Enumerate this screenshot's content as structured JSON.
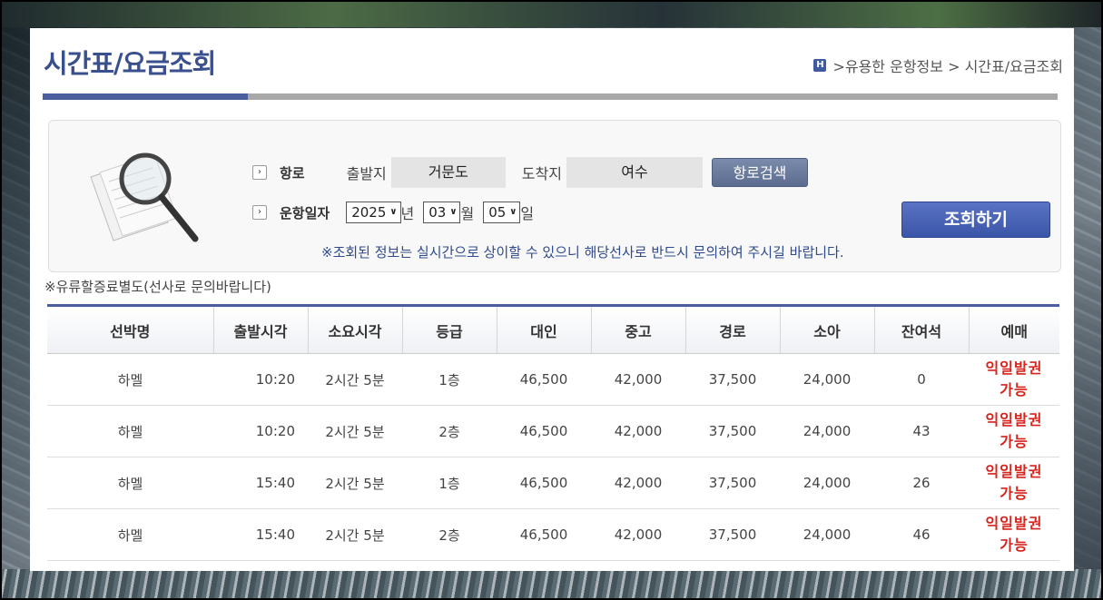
{
  "page": {
    "title": "시간표/요금조회",
    "breadcrumb": {
      "home_icon": "home-icon",
      "path": ">유용한 운항정보 > 시간표/요금조회"
    }
  },
  "search": {
    "route_label": "항로",
    "departure_label": "출발지",
    "departure_value": "거문도",
    "arrival_label": "도착지",
    "arrival_value": "여수",
    "route_button": "항로검색",
    "date_label": "운항일자",
    "year": "2025",
    "year_unit": "년",
    "month": "03",
    "month_unit": "월",
    "day": "05",
    "day_unit": "일",
    "submit_button": "조회하기",
    "notice": "※조회된 정보는 실시간으로 상이할 수 있으니 해당선사로 반드시 문의하여 주시길 바랍니다."
  },
  "discount_note": "※유류할증료별도(선사로 문의바랍니다)",
  "table": {
    "headers": [
      "선박명",
      "출발시각",
      "소요시각",
      "등급",
      "대인",
      "중고",
      "경로",
      "소아",
      "잔여석",
      "예매"
    ],
    "rows": [
      [
        "하멜",
        "10:20",
        "2시간 5분",
        "1층",
        "46,500",
        "42,000",
        "37,500",
        "24,000",
        "0",
        "익일발권",
        "가능"
      ],
      [
        "하멜",
        "10:20",
        "2시간 5분",
        "2층",
        "46,500",
        "42,000",
        "37,500",
        "24,000",
        "43",
        "익일발권",
        "가능"
      ],
      [
        "하멜",
        "15:40",
        "2시간 5분",
        "1층",
        "46,500",
        "42,000",
        "37,500",
        "24,000",
        "26",
        "익일발권",
        "가능"
      ],
      [
        "하멜",
        "15:40",
        "2시간 5분",
        "2층",
        "46,500",
        "42,000",
        "37,500",
        "24,000",
        "46",
        "익일발권",
        "가능"
      ]
    ]
  },
  "colors": {
    "accent": "#4b5e9b",
    "ticket": "#d6231c",
    "button": "#3b55a8"
  }
}
